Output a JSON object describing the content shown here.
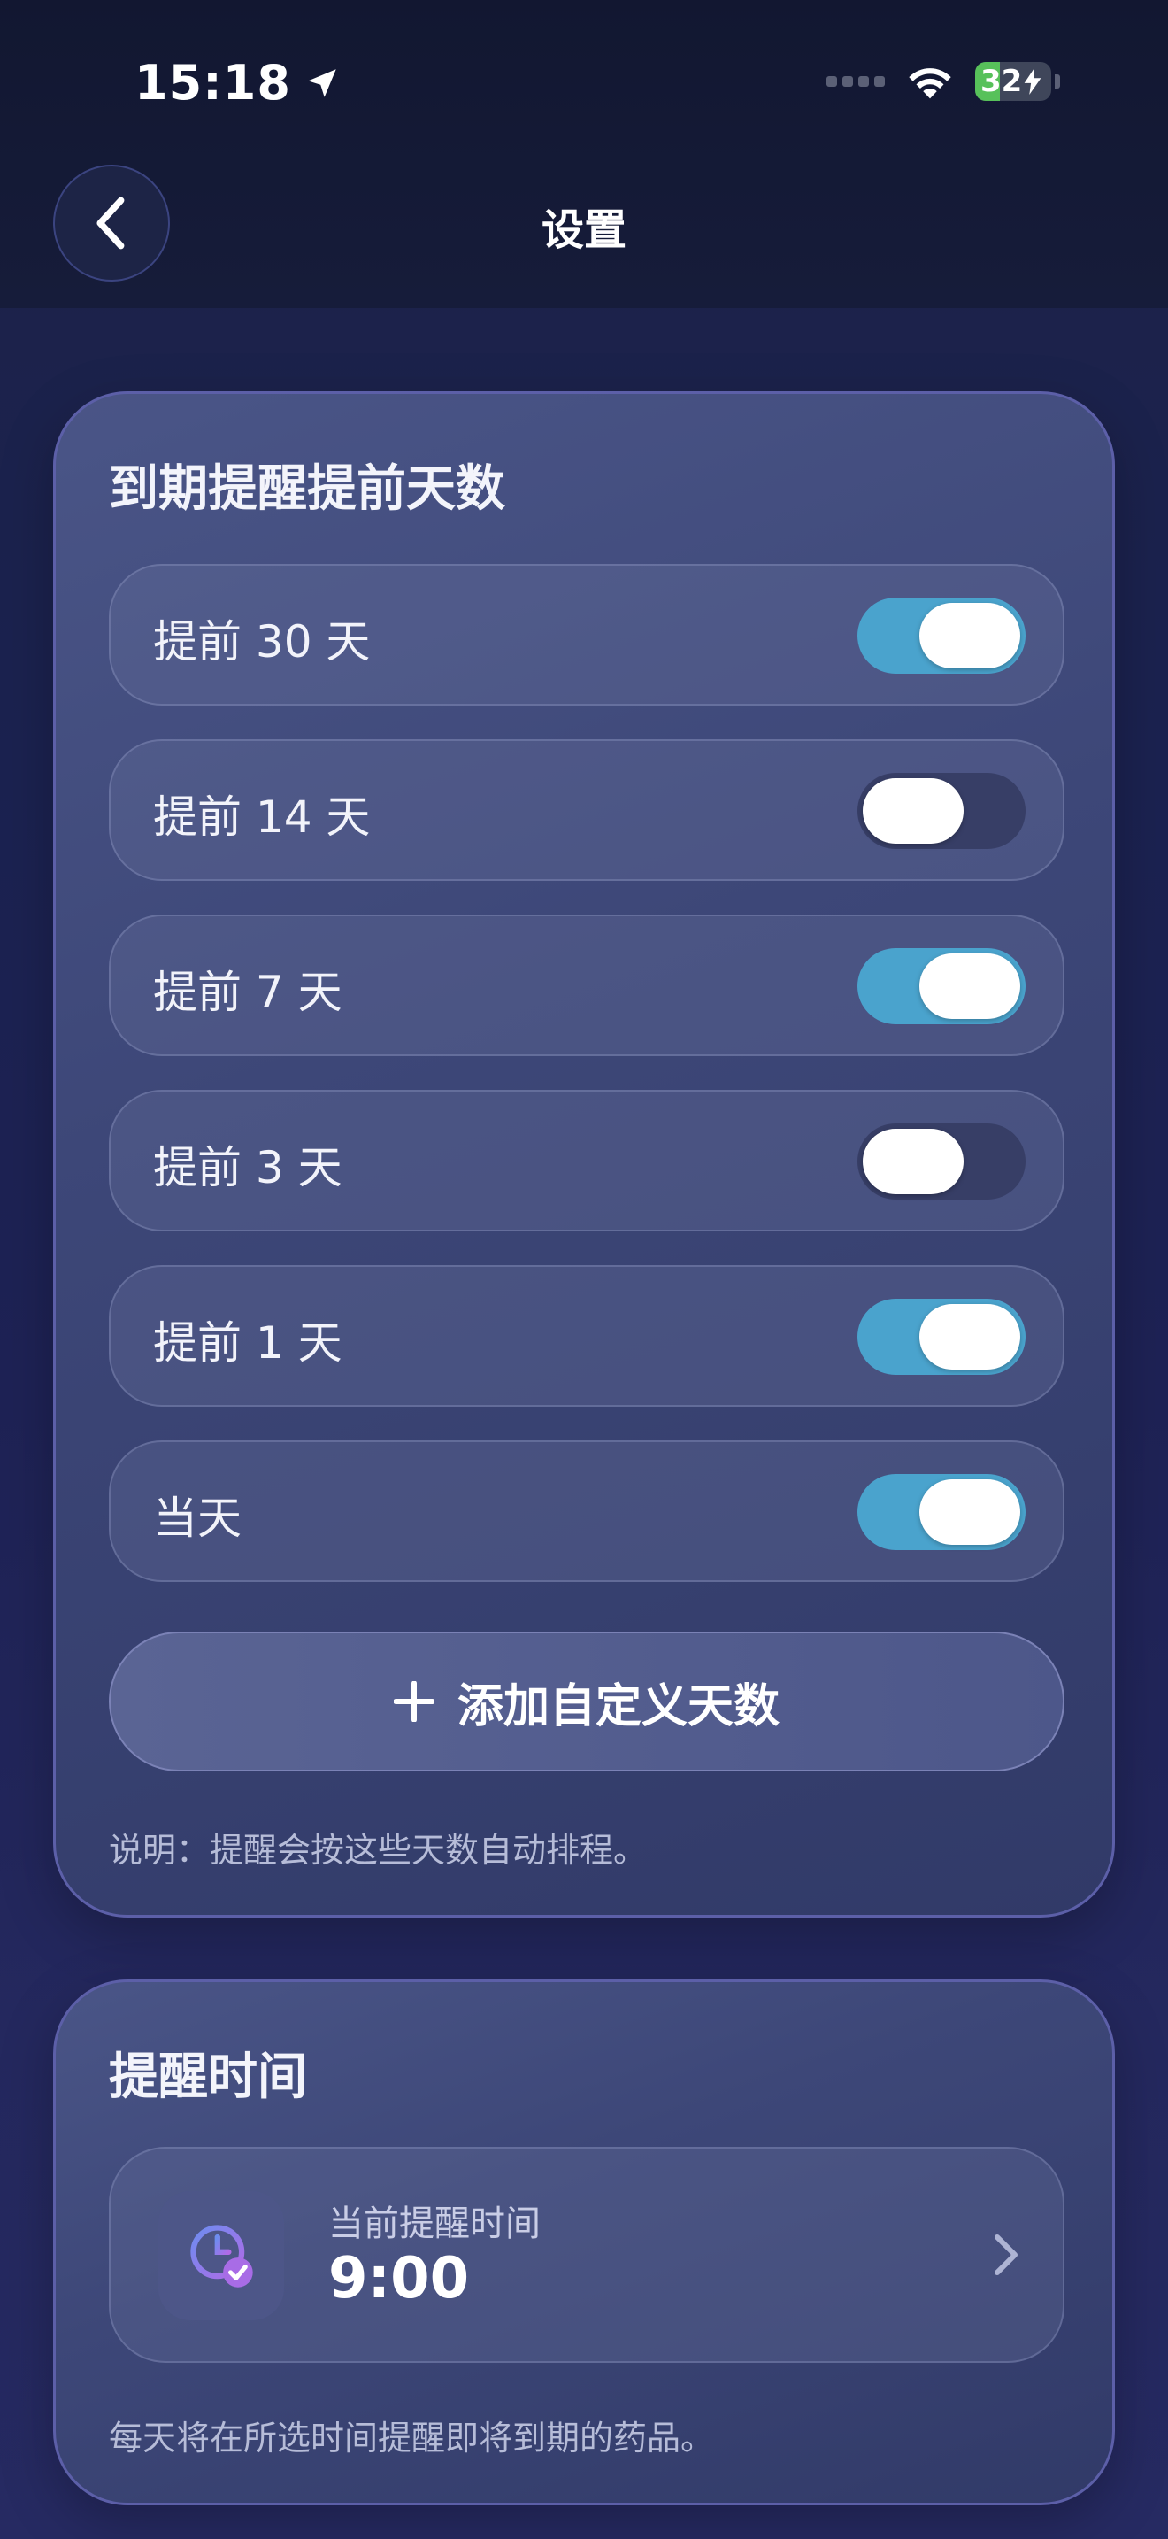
{
  "status_bar": {
    "time": "15:18",
    "battery": "32",
    "battery_level": 0.32
  },
  "header": {
    "title": "设置"
  },
  "expiry_card": {
    "title": "到期提醒提前天数",
    "items": [
      {
        "label": "提前 30 天",
        "on": true
      },
      {
        "label": "提前 14 天",
        "on": false
      },
      {
        "label": "提前 7 天",
        "on": true
      },
      {
        "label": "提前 3 天",
        "on": false
      },
      {
        "label": "提前 1 天",
        "on": true
      },
      {
        "label": "当天",
        "on": true
      }
    ],
    "add_label": "添加自定义天数",
    "note": "说明：提醒会按这些天数自动排程。"
  },
  "time_card": {
    "title": "提醒时间",
    "current_label": "当前提醒时间",
    "current_value": "9:00",
    "note": "每天将在所选时间提醒即将到期的药品。"
  },
  "colors": {
    "toggle_on": "#4aa3cd",
    "toggle_off": "#373e66",
    "accent": "#a86ce6"
  }
}
